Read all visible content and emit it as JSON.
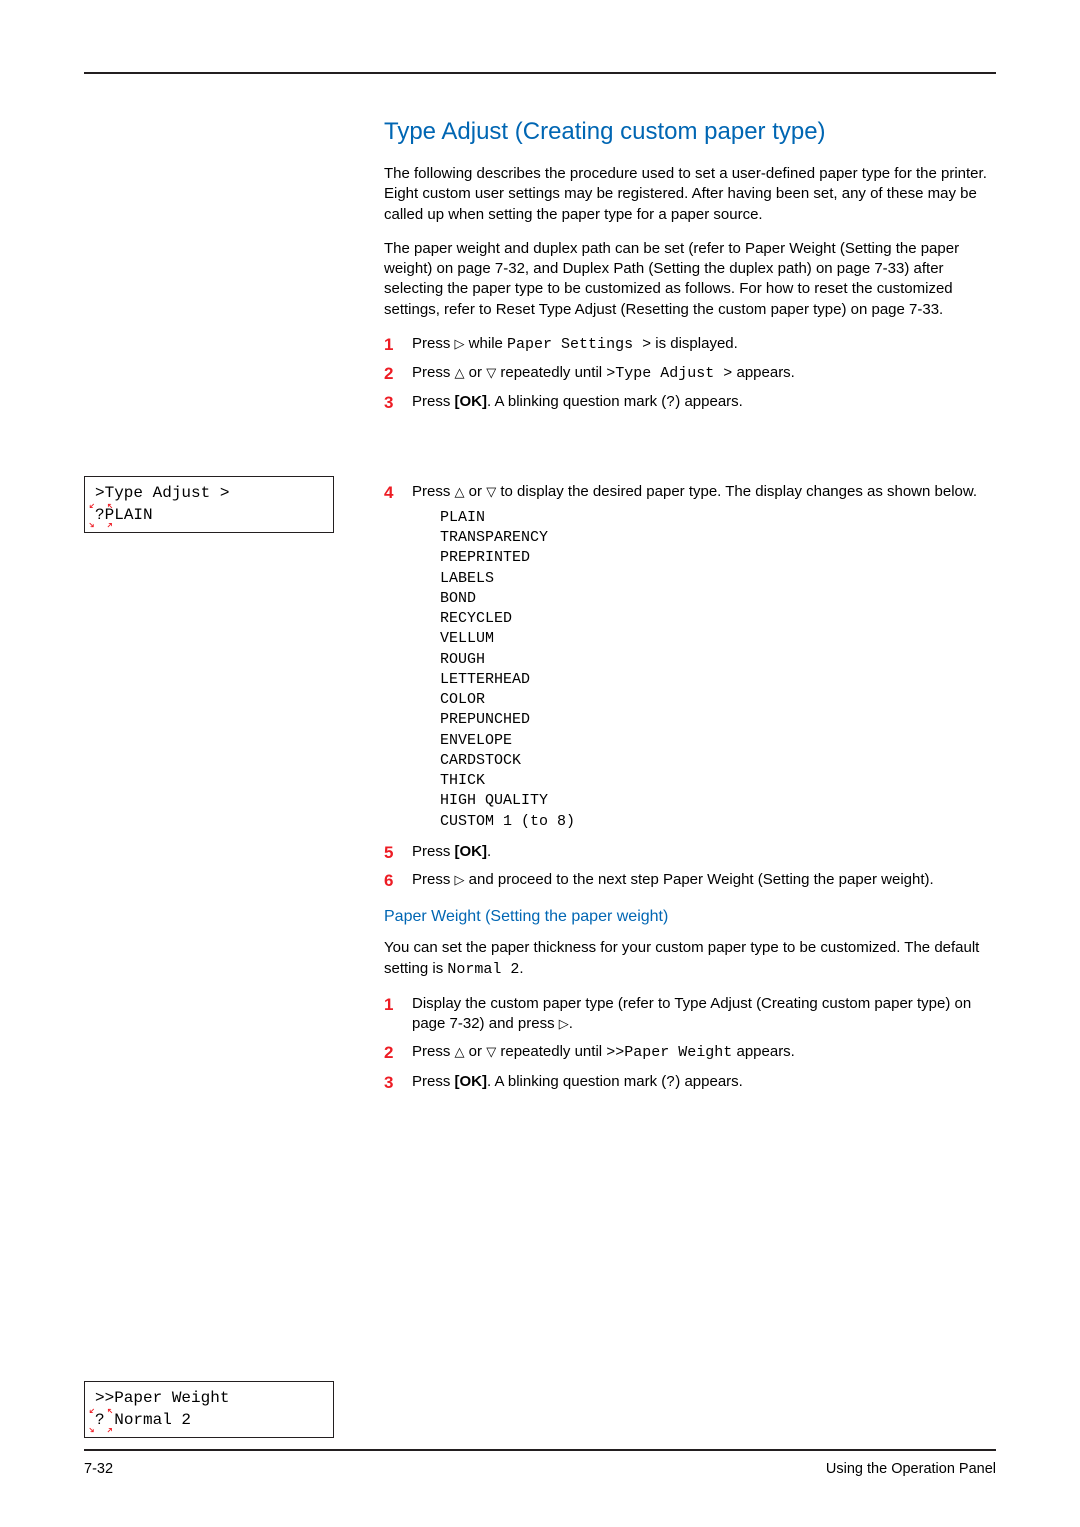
{
  "heading": "Type Adjust (Creating custom paper type)",
  "intro1": "The following describes the procedure used to set a user-defined paper type for the printer. Eight custom user settings may be registered. After having been set, any of these may be called up when setting the paper type for a paper source.",
  "intro2": "The paper weight and duplex path can be set (refer to Paper Weight (Setting the paper weight) on page 7-32, and Duplex Path (Setting the duplex path) on page 7-33) after selecting the paper type to be customized as follows. For how to reset the customized settings, refer to Reset Type Adjust (Resetting the custom paper type) on page 7-33.",
  "steps1": {
    "s1a": "Press ",
    "s1b": " while ",
    "s1c": "Paper Settings >",
    "s1d": " is displayed.",
    "s2a": "Press ",
    "s2b": " or ",
    "s2c": " repeatedly until ",
    "s2d": ">Type Adjust >",
    "s2e": " appears.",
    "s3a": "Press ",
    "s3b": "[OK]",
    "s3c": ". A blinking question mark (",
    "s3d": "?",
    "s3e": ") appears.",
    "s4a": "Press ",
    "s4b": " or ",
    "s4c": " to display the desired paper type. The display changes as shown below.",
    "s5a": "Press ",
    "s5b": "[OK]",
    "s5c": ".",
    "s6a": "Press ",
    "s6b": " and proceed to the next step Paper Weight (Setting the paper weight)."
  },
  "types": [
    "PLAIN",
    "TRANSPARENCY",
    "PREPRINTED",
    "LABELS",
    "BOND",
    "RECYCLED",
    "VELLUM",
    "ROUGH",
    "LETTERHEAD",
    "COLOR",
    "PREPUNCHED",
    "ENVELOPE",
    "CARDSTOCK",
    "THICK",
    "HIGH QUALITY",
    "CUSTOM 1 (to 8)"
  ],
  "subheading": "Paper Weight (Setting the paper weight)",
  "sub_intro_a": "You can set the paper thickness for your custom paper type to be customized. The default setting is ",
  "sub_intro_b": "Normal 2",
  "sub_intro_c": ".",
  "steps2": {
    "s1": "Display the custom paper type (refer to Type Adjust (Creating custom paper type) on page 7-32) and press ",
    "s1b": ".",
    "s2a": "Press ",
    "s2b": " or ",
    "s2c": " repeatedly until ",
    "s2d": ">>Paper Weight",
    "s2e": " appears.",
    "s3a": "Press ",
    "s3b": "[OK]",
    "s3c": ". A blinking question mark (",
    "s3d": "?",
    "s3e": ") appears."
  },
  "lcd1": {
    "line1": ">Type Adjust   >",
    "line2a": "?",
    "line2b": "PLAIN"
  },
  "lcd2": {
    "line1": ">>Paper Weight",
    "line2a": "?",
    "line2b": " Normal 2"
  },
  "glyphs": {
    "right": "▷",
    "up": "△",
    "down": "▽"
  },
  "footer": {
    "page": "7-32",
    "label": "Using the Operation Panel"
  }
}
